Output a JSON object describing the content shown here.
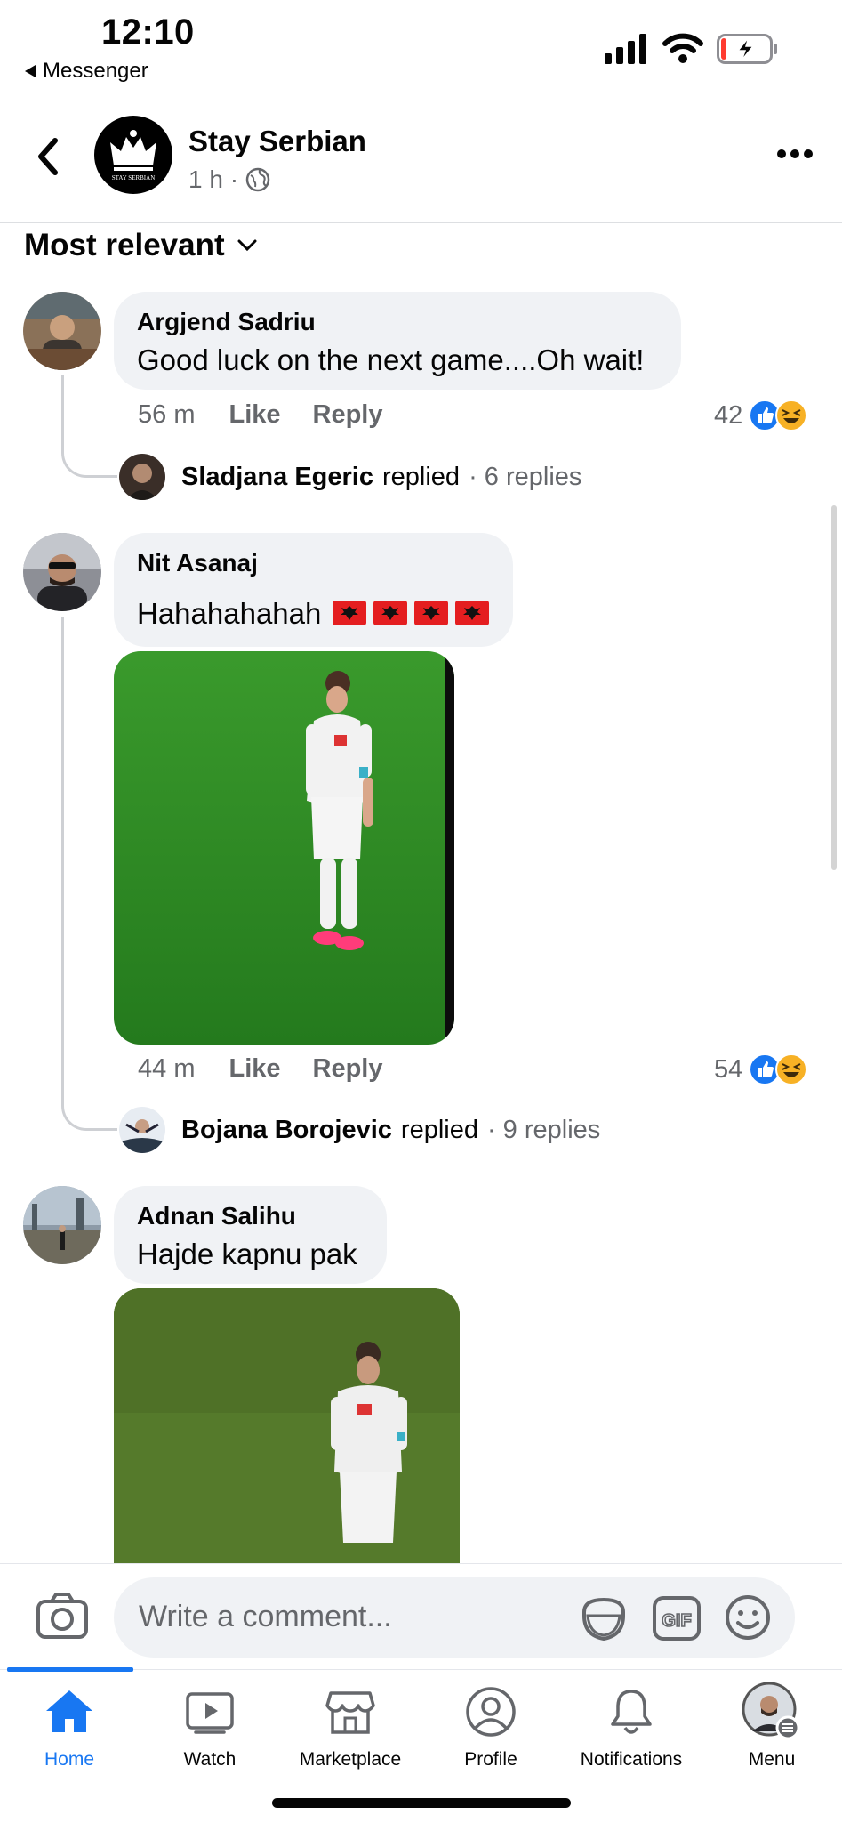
{
  "status_bar": {
    "time": "12:10",
    "back_app": "Messenger"
  },
  "header": {
    "page_name": "Stay Serbian",
    "meta": "1 h ·",
    "logo_text": "STAY SERBIAN"
  },
  "sort": {
    "label": "Most relevant"
  },
  "comments": [
    {
      "author": "Argjend Sadriu",
      "text": "Good luck on the next game....Oh wait!",
      "time": "56 m",
      "like": "Like",
      "reply": "Reply",
      "reactions": "42",
      "replied_by": "Sladjana Egeric",
      "replied_word": "replied",
      "replies": "· 6 replies"
    },
    {
      "author": "Nit Asanaj",
      "text": "Hahahahahah",
      "time": "44 m",
      "like": "Like",
      "reply": "Reply",
      "reactions": "54",
      "replied_by": "Bojana Borojevic",
      "replied_word": "replied",
      "replies": "· 9 replies"
    },
    {
      "author": "Adnan Salihu",
      "text": "Hajde kapnu pak"
    }
  ],
  "composer": {
    "placeholder": "Write a comment..."
  },
  "tabs": [
    {
      "label": "Home",
      "icon": "home-icon",
      "active": true
    },
    {
      "label": "Watch",
      "icon": "watch-icon"
    },
    {
      "label": "Marketplace",
      "icon": "marketplace-icon"
    },
    {
      "label": "Profile",
      "icon": "profile-icon"
    },
    {
      "label": "Notifications",
      "icon": "bell-icon"
    },
    {
      "label": "Menu",
      "icon": "avatar-menu-icon"
    }
  ],
  "colors": {
    "accent": "#1877f2",
    "bubble": "#f0f2f5",
    "muted": "#65676b",
    "haha": "#f7b125",
    "pitch": "#2f8a25"
  }
}
